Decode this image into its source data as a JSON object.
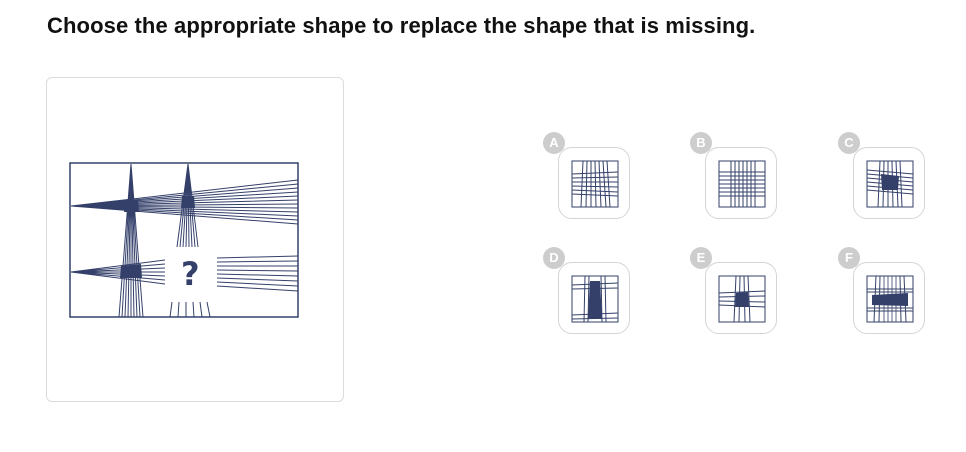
{
  "question": {
    "title": "Choose the appropriate shape to replace the shape that is missing."
  },
  "puzzle": {
    "missing_marker": "?",
    "stroke_color": "#34406a"
  },
  "options": [
    {
      "label": "A",
      "pattern": "grid-vertical-and-horizontal-lines",
      "fill": "none"
    },
    {
      "label": "B",
      "pattern": "dense-grid",
      "fill": "none"
    },
    {
      "label": "C",
      "pattern": "grid-with-filled-trapezoid-top",
      "fill": "filled"
    },
    {
      "label": "D",
      "pattern": "grid-with-filled-vertical-trapezoid",
      "fill": "filled"
    },
    {
      "label": "E",
      "pattern": "grid-with-filled-square-center",
      "fill": "filled"
    },
    {
      "label": "F",
      "pattern": "grid-with-filled-horizontal-trapezoid",
      "fill": "filled"
    }
  ],
  "colors": {
    "line": "#34406a",
    "badge": "#cdcdcd",
    "card_border": "#dcdcdc"
  }
}
